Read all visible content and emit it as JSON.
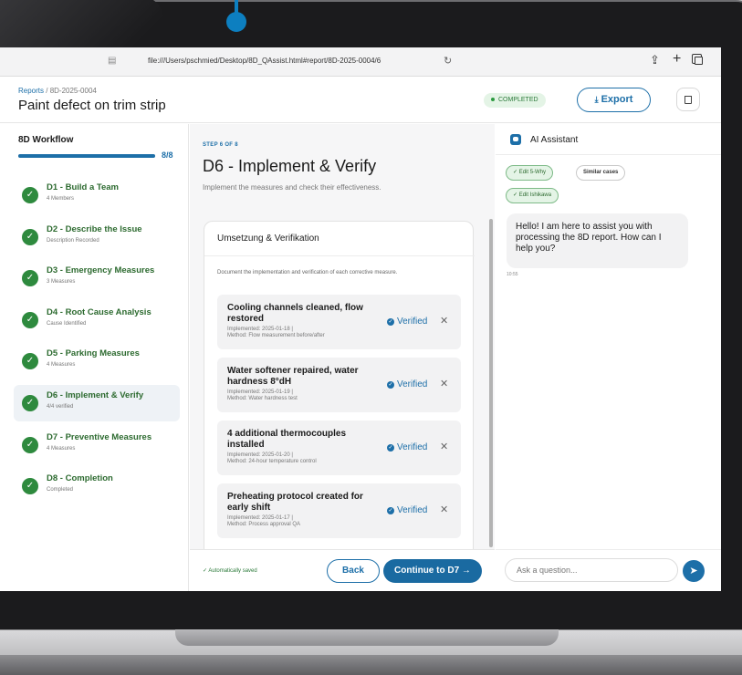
{
  "browser": {
    "url": "file:///Users/pschmied/Desktop/8D_QAssist.html#report/8D-2025-0004/6"
  },
  "header": {
    "breadcrumb_root": "Reports",
    "breadcrumb_sep": " / ",
    "breadcrumb_current": "8D-2025-0004",
    "title": "Paint defect on trim strip",
    "status": "COMPLETED",
    "export_label": "Export"
  },
  "sidebar": {
    "title": "8D Workflow",
    "progress_label": "8/8",
    "progress_fraction": 1.0,
    "steps": [
      {
        "label": "D1 - Build a Team",
        "sub": "4 Members"
      },
      {
        "label": "D2 - Describe the Issue",
        "sub": "Description Recorded"
      },
      {
        "label": "D3 - Emergency Measures",
        "sub": "3 Measures"
      },
      {
        "label": "D4 - Root Cause Analysis",
        "sub": "Cause Identified"
      },
      {
        "label": "D5 - Parking Measures",
        "sub": "4 Measures"
      },
      {
        "label": "D6 - Implement & Verify",
        "sub": "4/4 verified"
      },
      {
        "label": "D7 - Preventive Measures",
        "sub": "4 Measures"
      },
      {
        "label": "D8 - Completion",
        "sub": "Completed"
      }
    ]
  },
  "main": {
    "kicker": "STEP 6 OF 8",
    "title": "D6 - Implement & Verify",
    "subtitle": "Implement the measures and check their effectiveness.",
    "card_title": "Umsetzung & Verifikation",
    "card_desc": "Document the implementation and verification of each corrective measure.",
    "measures": [
      {
        "title": "Cooling channels cleaned, flow restored",
        "implemented": "Implemented: 2025-01-18 |",
        "method": "Method: Flow measurement before/after",
        "status": "Verified"
      },
      {
        "title": "Water softener repaired, water hardness 8°dH",
        "implemented": "Implemented: 2025-01-19 |",
        "method": "Method: Water hardness test",
        "status": "Verified"
      },
      {
        "title": "4 additional thermocouples installed",
        "implemented": "Implemented: 2025-01-20 |",
        "method": "Method: 24-hour temperature control",
        "status": "Verified"
      },
      {
        "title": "Preheating protocol created for early shift",
        "implemented": "Implemented: 2025-01-17 |",
        "method": "Method: Process approval QA",
        "status": "Verified"
      }
    ],
    "autosave": "Automatically saved",
    "back_label": "Back",
    "continue_label": "Continue to D7 →"
  },
  "assistant": {
    "title": "AI Assistant",
    "chips": [
      "✓ Edit 5-Why",
      "Similar cases",
      "✓ Edit Ishikawa"
    ],
    "message": "Hello! I am here to assist you with processing the 8D report. How can I help you?",
    "time": "10:55",
    "input_placeholder": "Ask a question..."
  }
}
